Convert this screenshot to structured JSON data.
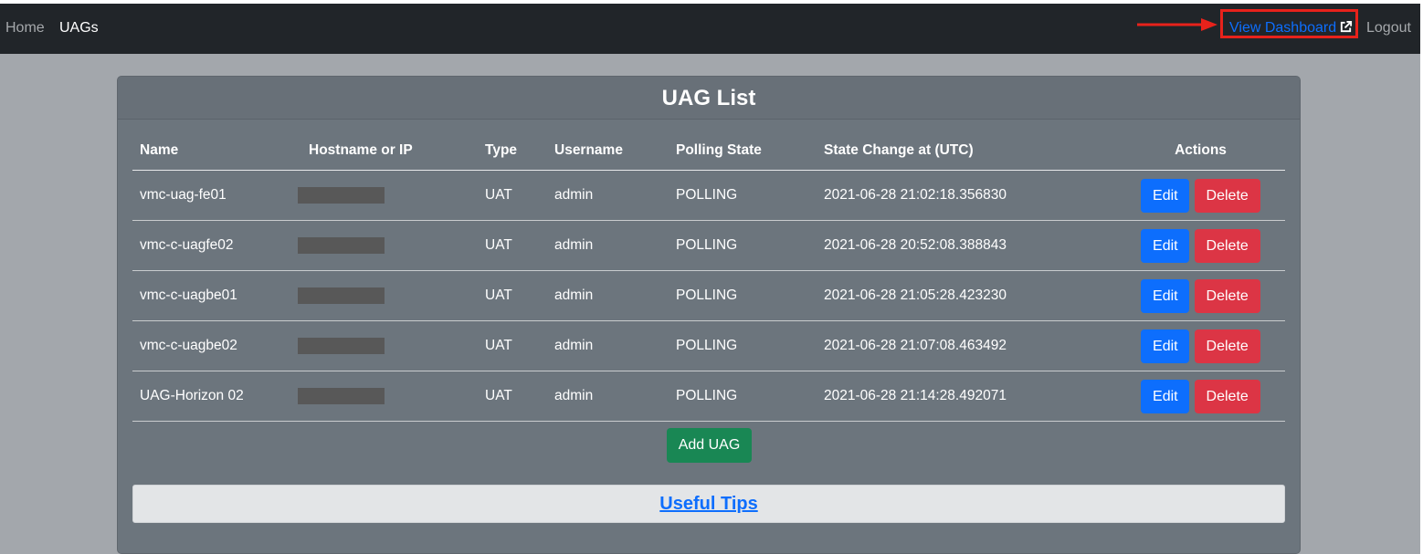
{
  "nav": {
    "home": "Home",
    "uags": "UAGs",
    "view_dashboard": "View Dashboard",
    "logout": "Logout"
  },
  "card": {
    "title": "UAG List",
    "columns": [
      "Name",
      "Hostname or IP",
      "Type",
      "Username",
      "Polling State",
      "State Change at (UTC)",
      "Actions"
    ],
    "rows": [
      {
        "name": "vmc-uag-fe01",
        "hostname": "",
        "type": "UAT",
        "username": "admin",
        "polling_state": "POLLING",
        "state_change": "2021-06-28 21:02:18.356830"
      },
      {
        "name": "vmc-c-uagfe02",
        "hostname": "",
        "type": "UAT",
        "username": "admin",
        "polling_state": "POLLING",
        "state_change": "2021-06-28 20:52:08.388843"
      },
      {
        "name": "vmc-c-uagbe01",
        "hostname": "",
        "type": "UAT",
        "username": "admin",
        "polling_state": "POLLING",
        "state_change": "2021-06-28 21:05:28.423230"
      },
      {
        "name": "vmc-c-uagbe02",
        "hostname": "",
        "type": "UAT",
        "username": "admin",
        "polling_state": "POLLING",
        "state_change": "2021-06-28 21:07:08.463492"
      },
      {
        "name": "UAG-Horizon 02",
        "hostname": "",
        "type": "UAT",
        "username": "admin",
        "polling_state": "POLLING",
        "state_change": "2021-06-28 21:14:28.492071"
      }
    ],
    "edit_label": "Edit",
    "delete_label": "Delete",
    "add_label": "Add UAG",
    "tips_label": "Useful Tips"
  },
  "icons": {
    "external_link": "external-link-icon",
    "annotation_arrow": "arrow-right-icon"
  },
  "colors": {
    "navbar": "#212529",
    "card": "#6c757d",
    "primary": "#0d6efd",
    "danger": "#dc3545",
    "success": "#198754",
    "highlight": "#e8221b"
  }
}
